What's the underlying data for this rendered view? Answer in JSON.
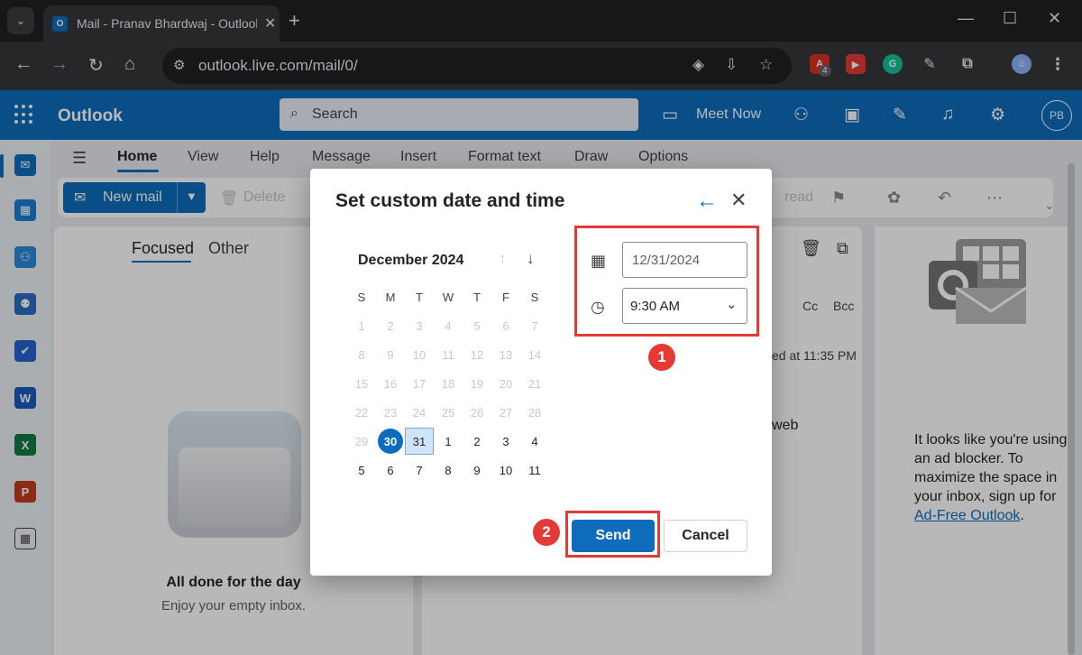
{
  "browser": {
    "tab_title": "Mail - Pranav Bhardwaj - Outlook",
    "url": "outlook.live.com/mail/0/",
    "extension_badge": "4"
  },
  "outlook": {
    "brand": "Outlook",
    "search_placeholder": "Search",
    "meet_now": "Meet Now",
    "avatar_initials": "PB"
  },
  "ribbon": {
    "tabs": [
      "Home",
      "View",
      "Help",
      "Message",
      "Insert",
      "Format text",
      "Draw",
      "Options"
    ],
    "new_mail": "New mail",
    "delete": "Delete",
    "read": "read"
  },
  "mail_list": {
    "tabs": [
      "Focused",
      "Other"
    ],
    "empty_title": "All done for the day",
    "empty_subtitle": "Enjoy your empty inbox."
  },
  "reading_pane": {
    "cc": "Cc",
    "bcc": "Bcc",
    "saved_text": "ed at 11:35 PM",
    "body_fragment": "web"
  },
  "ad_pane": {
    "text": "It looks like you're using an ad blocker. To maximize the space in your inbox, sign up for ",
    "link": "Ad-Free Outlook",
    "suffix": "."
  },
  "dialog": {
    "title": "Set custom date and time",
    "calendar": {
      "month_label": "December 2024",
      "weekdays": [
        "S",
        "M",
        "T",
        "W",
        "T",
        "F",
        "S"
      ],
      "weeks": [
        [
          "1",
          "2",
          "3",
          "4",
          "5",
          "6",
          "7"
        ],
        [
          "8",
          "9",
          "10",
          "11",
          "12",
          "13",
          "14"
        ],
        [
          "15",
          "16",
          "17",
          "18",
          "19",
          "20",
          "21"
        ],
        [
          "22",
          "23",
          "24",
          "25",
          "26",
          "27",
          "28"
        ],
        [
          "29",
          "30",
          "31",
          "1",
          "2",
          "3",
          "4"
        ],
        [
          "5",
          "6",
          "7",
          "8",
          "9",
          "10",
          "11"
        ]
      ],
      "today": "30",
      "selected": "31"
    },
    "date_value": "12/31/2024",
    "time_value": "9:30 AM",
    "send_label": "Send",
    "cancel_label": "Cancel"
  },
  "callouts": [
    "1",
    "2"
  ],
  "colors": {
    "outlook_blue": "#0f6cbd",
    "callout_red": "#e53935"
  }
}
